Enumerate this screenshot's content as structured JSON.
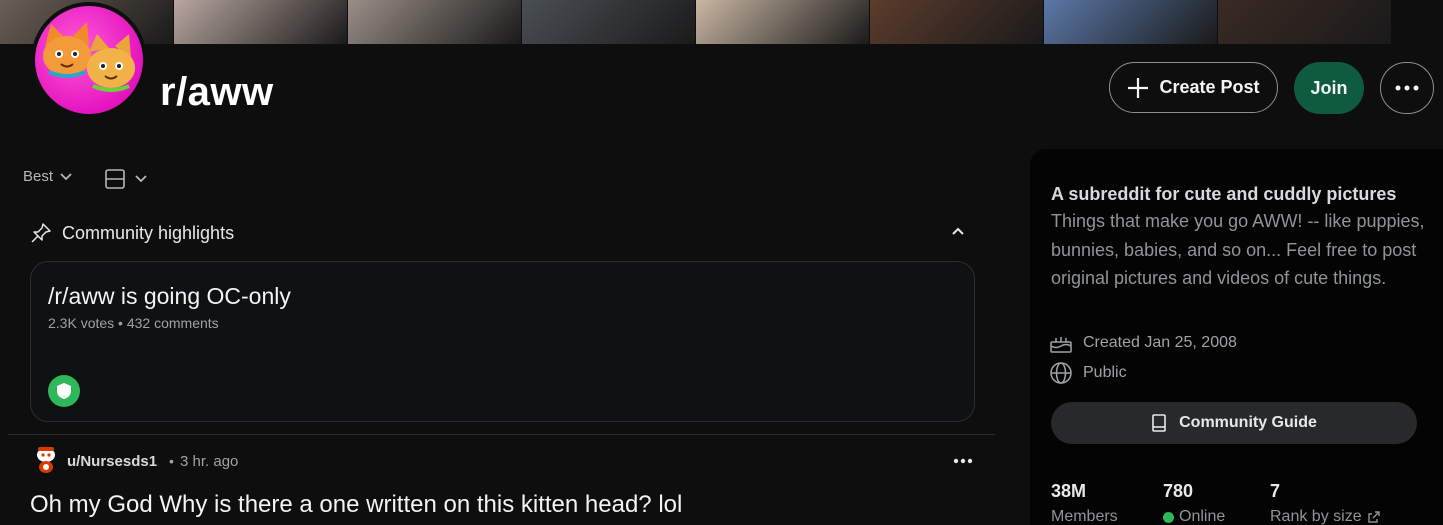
{
  "banner": {
    "tiles": [
      "#6b5f55",
      "#b9a7a0",
      "#9a8f87",
      "#4a4f55",
      "#c9b7a3",
      "#5c3c2c",
      "#5b78a8",
      "#3a2a24"
    ]
  },
  "header": {
    "title": "r/aww",
    "create_post_label": "Create Post",
    "join_label": "Join"
  },
  "feed": {
    "sort_label": "Best",
    "highlights": {
      "heading": "Community highlights",
      "card_title": "/r/aww is going OC-only",
      "card_meta": "2.3K votes • 432 comments"
    },
    "post": {
      "user": "u/Nursesds1",
      "separator": "•",
      "time": "3 hr. ago",
      "title": "Oh my God Why is there a one written on this kitten head? lol"
    }
  },
  "sidebar": {
    "headline": "A subreddit for cute and cuddly pictures",
    "description": "Things that make you go AWW! -- like puppies, bunnies, babies, and so on... Feel free to post original pictures and videos of cute things.",
    "created": "Created Jan 25, 2008",
    "visibility": "Public",
    "guide_label": "Community Guide",
    "stats": {
      "members_value": "38M",
      "members_label": "Members",
      "online_value": "780",
      "online_label": "Online",
      "rank_value": "7",
      "rank_label": "Rank by size"
    }
  },
  "colors": {
    "join_bg": "#0e5b3f",
    "online_green": "#2fb85a",
    "avatar_pink": "#e514c0"
  }
}
